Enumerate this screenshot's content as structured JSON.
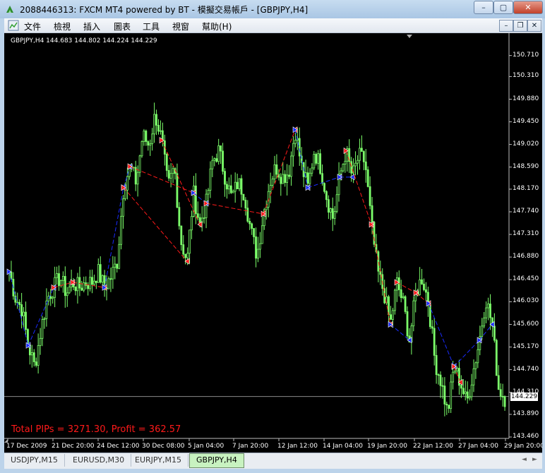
{
  "window": {
    "title": "2088446313: FXCM MT4 powered by BT - 模擬交易帳戶 - [GBPJPY,H4]",
    "minimize": "–",
    "maximize": "▢",
    "close": "✕"
  },
  "menu": {
    "items": [
      "文件",
      "檢視",
      "插入",
      "圖表",
      "工具",
      "視窗",
      "幫助(H)"
    ],
    "mdi_min": "–",
    "mdi_restore": "❐",
    "mdi_close": "✕"
  },
  "chart": {
    "ohlc": "GBPJPY,H4  144.683 144.802 144.224 144.229",
    "summary": "Total PIPs = 3271.30, Profit = 362.57",
    "current_price": "144.229",
    "colors": {
      "background": "#000000",
      "candles": "#7cff6a",
      "buy_line": "#1a2cff",
      "sell_line": "#ff1a1a",
      "text": "#ffffff"
    }
  },
  "chart_data": {
    "type": "line",
    "symbol": "GBPJPY",
    "timeframe": "H4",
    "ylim": [
      143.46,
      150.92
    ],
    "y_ticks": [
      150.71,
      150.31,
      149.88,
      149.45,
      149.02,
      148.59,
      148.17,
      147.74,
      147.31,
      146.88,
      146.45,
      146.03,
      145.6,
      145.17,
      144.74,
      144.31,
      143.89,
      143.46
    ],
    "x_tick_labels": [
      "17 Dec 2009",
      "21 Dec 20:00",
      "24 Dec 12:00",
      "30 Dec 08:00",
      "5 Jan 04:00",
      "7 Jan 20:00",
      "12 Jan 12:00",
      "14 Jan 04:00",
      "19 Jan 20:00",
      "22 Jan 12:00",
      "27 Jan 04:00",
      "29 Jan 20:00"
    ],
    "price_path": [
      146.6,
      146.1,
      145.9,
      145.2,
      144.8,
      145.5,
      146.1,
      146.3,
      146.5,
      146.2,
      146.4,
      146.3,
      146.4,
      146.4,
      146.6,
      146.3,
      146.5,
      146.8,
      148.2,
      148.6,
      148.3,
      149.2,
      149.0,
      149.6,
      149.1,
      148.2,
      148.6,
      147.2,
      146.8,
      148.1,
      147.5,
      147.9,
      148.7,
      148.9,
      148.4,
      148.0,
      148.3,
      148.1,
      147.4,
      146.9,
      147.7,
      148.3,
      148.6,
      148.4,
      148.5,
      149.3,
      148.6,
      148.2,
      148.9,
      148.6,
      148.0,
      147.6,
      148.4,
      148.9,
      148.4,
      148.8,
      148.7,
      147.5,
      146.6,
      146.2,
      145.6,
      146.4,
      146.0,
      145.3,
      146.2,
      146.5,
      146.0,
      144.9,
      144.5,
      143.9,
      144.8,
      144.5,
      144.1,
      144.7,
      145.3,
      146.1,
      145.6,
      144.4,
      144.2
    ],
    "y_unit": "JPY",
    "last_price": 144.229
  },
  "tabs": [
    {
      "label": "USDJPY,M15",
      "active": false
    },
    {
      "label": "EURUSD,M30",
      "active": false
    },
    {
      "label": "EURJPY,M15",
      "active": false
    },
    {
      "label": "GBPJPY,H4",
      "active": true
    }
  ],
  "tab_nav": {
    "prev": "◄",
    "next": "►"
  }
}
